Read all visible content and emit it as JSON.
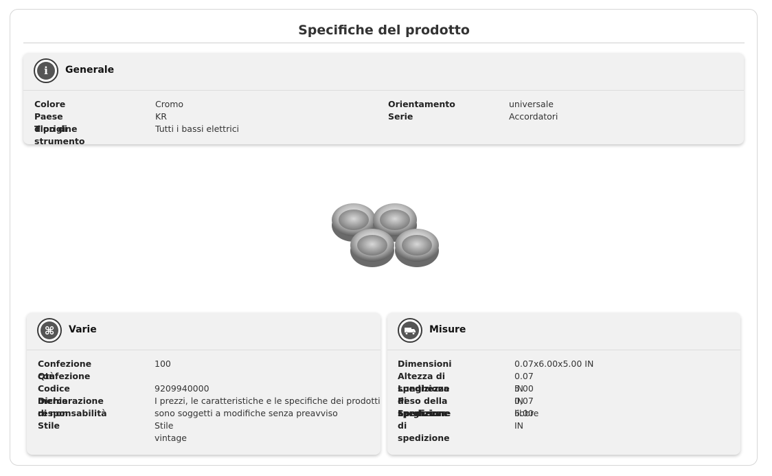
{
  "page_title": "Specifiche del prodotto",
  "generale": {
    "title": "Generale",
    "icon": "info-icon",
    "left": [
      {
        "label": "Colore",
        "value": "Cromo"
      },
      {
        "label": "Paese d'origine",
        "value": "KR"
      },
      {
        "label": "Tipo di strumento",
        "value": "Tutti i bassi elettrici"
      }
    ],
    "right": [
      {
        "label": "Orientamento",
        "value": "universale"
      },
      {
        "label": "Serie",
        "value": "Accordatori"
      }
    ]
  },
  "product_image": {
    "alt": "tuner-bushings-image"
  },
  "varie": {
    "title": "Varie",
    "icon": "command-icon",
    "rows": [
      {
        "label_l1": "Confezione confezione",
        "label_l2": "Qtà",
        "value_l1": "100",
        "value_l2": ""
      },
      {
        "label_l1": "Codice merce",
        "label_l2": "",
        "value_l1": "9209940000",
        "value_l2": ""
      },
      {
        "label_l1": "Dichiarazione di non",
        "label_l2": "responsabilità",
        "value_l1": "I prezzi, le caratteristiche e le specifiche dei prodotti",
        "value_l2": "sono soggetti a modifiche senza preavviso"
      },
      {
        "label_l1": "Stile",
        "label_l2": "",
        "value_l1": "Stile vintage",
        "value_l2": ""
      }
    ]
  },
  "misure": {
    "title": "Misure",
    "icon": "shipping-truck-icon",
    "rows": [
      {
        "label": "Dimensioni",
        "value": "0.07x6.00x5.00 IN"
      },
      {
        "label": "Altezza di spedizione",
        "value": "0.07 IN"
      },
      {
        "label": "Lunghezza di spedizione",
        "value": "5.00 IN"
      },
      {
        "label": "Peso della Spedizione",
        "value": "0,07 libbre"
      },
      {
        "label": "Larghezza di spedizione",
        "value": "6.00 IN"
      }
    ]
  }
}
